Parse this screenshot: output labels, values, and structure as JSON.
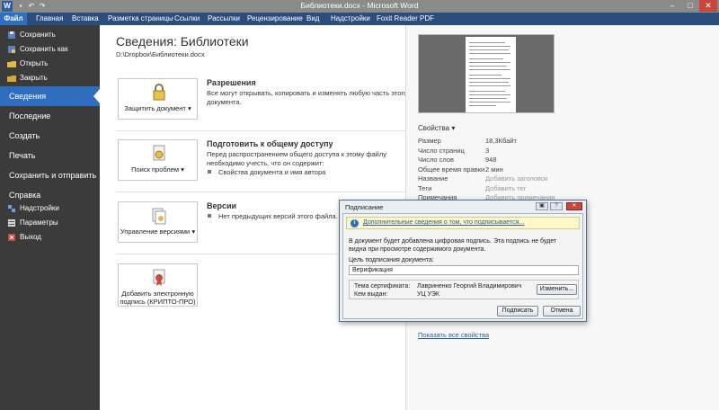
{
  "window": {
    "title": "Библиотеки.docx - Microsoft Word",
    "app_icon": "W",
    "qat": [
      "save-icon",
      "undo-icon",
      "redo-icon"
    ]
  },
  "ribbon_tabs": [
    "Файл",
    "Главная",
    "Вставка",
    "Разметка страницы",
    "Ссылки",
    "Рассылки",
    "Рецензирование",
    "Вид",
    "Надстройки",
    "Foxit Reader PDF"
  ],
  "nav": {
    "save": "Сохранить",
    "save_as": "Сохранить как",
    "open": "Открыть",
    "close": "Закрыть",
    "info": "Сведения",
    "recent": "Последние",
    "new": "Создать",
    "print": "Печать",
    "save_send": "Сохранить и отправить",
    "help": "Справка",
    "addins": "Надстройки",
    "options": "Параметры",
    "exit": "Выход"
  },
  "info": {
    "title": "Сведения: Библиотеки",
    "path": "D:\\Dropbox\\Библиотеки.docx",
    "permissions": {
      "button": "Защитить документ",
      "title": "Разрешения",
      "text": "Все могут открывать, копировать и изменять любую часть этого документа."
    },
    "prepare": {
      "button": "Поиск проблем",
      "title": "Подготовить к общему доступу",
      "text": "Перед распространением общего доступа к этому файлу необходимо учесть, что он содержит:",
      "bullet": "Свойства документа и имя автора"
    },
    "versions": {
      "button": "Управление версиями",
      "title": "Версии",
      "text": "Нет предыдущих версий этого файла."
    },
    "sign": {
      "button": "Добавить электронную подпись (КРИПТО-ПРО)"
    }
  },
  "properties": {
    "title": "Свойства",
    "rows": [
      {
        "key": "Размер",
        "value": "18,3Кбайт",
        "placeholder": false
      },
      {
        "key": "Число страниц",
        "value": "3",
        "placeholder": false
      },
      {
        "key": "Число слов",
        "value": "948",
        "placeholder": false
      },
      {
        "key": "Общее время правки",
        "value": "2 мин",
        "placeholder": false
      },
      {
        "key": "Название",
        "value": "Добавить заголовок",
        "placeholder": true
      },
      {
        "key": "Теги",
        "value": "Добавить тег",
        "placeholder": true
      },
      {
        "key": "Примечания",
        "value": "Добавить примечания",
        "placeholder": true
      }
    ],
    "show_all": "Показать все свойства"
  },
  "dialog": {
    "title": "Подписание",
    "info_link": "Дополнительные сведения о том, что подписывается...",
    "message": "В документ будет добавлена цифровая подпись. Эта подпись не будет видна при просмотре содержимого документа.",
    "purpose_label": "Цель подписания документа:",
    "purpose_value": "Верификация",
    "cert_subject_label": "Тема сертификата:",
    "cert_subject": "Лавриненко Георгий Владимирович",
    "issued_by_label": "Кем выдан:",
    "issued_by": "УЦ УЭК",
    "change_button": "Изменить...",
    "sign_button": "Подписать",
    "cancel_button": "Отмена"
  },
  "colors": {
    "nav_bg": "#3b3b3b",
    "nav_active": "#2f6dbf",
    "ribbon_bg": "#2b4d7e",
    "file_tab": "#2d6fc4",
    "link": "#2a5ea8"
  }
}
